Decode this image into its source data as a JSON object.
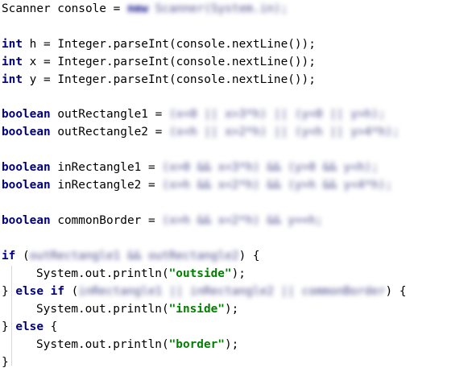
{
  "code": {
    "l1": {
      "a": "Scanner console = ",
      "b_kw": "new",
      "b_rest": " Scanner(System.in);"
    },
    "l3": {
      "kw": "int",
      "rest": " h = Integer.parseInt(console.nextLine());"
    },
    "l4": {
      "kw": "int",
      "rest": " x = Integer.parseInt(console.nextLine());"
    },
    "l5": {
      "kw": "int",
      "rest": " y = Integer.parseInt(console.nextLine());"
    },
    "l7": {
      "kw": "boolean",
      "rest": " outRectangle1 = ",
      "blurred": "(x<0 || x>3*h) || (y<0 || y>h);"
    },
    "l8": {
      "kw": "boolean",
      "rest": " outRectangle2 = ",
      "blurred": "(x<h || x>2*h) || (y<h || y>4*h);"
    },
    "l10": {
      "kw": "boolean",
      "rest": " inRectangle1 = ",
      "blurred": "(x>0 && x<3*h) && (y>0 && y<h);"
    },
    "l11": {
      "kw": "boolean",
      "rest": " inRectangle2 = ",
      "blurred": "(x>h && x<2*h) && (y>h && y<4*h);"
    },
    "l13": {
      "kw": "boolean",
      "rest": " commonBorder = ",
      "blurred": "(x>h && x<2*h) && y==h;"
    },
    "l15": {
      "kw": "if",
      "a": " (",
      "blurred": "outRectangle1 && outRectangle2",
      "b": ") {"
    },
    "l16": {
      "a": "System.out.println(",
      "str": "\"outside\"",
      "b": ");"
    },
    "l17": {
      "a": "} ",
      "kw1": "else",
      "mid": " ",
      "kw2": "if",
      "b": " (",
      "blurred": "inRectangle1 || inRectangle2 || commonBorder",
      "c": ") {"
    },
    "l18": {
      "a": "System.out.println(",
      "str": "\"inside\"",
      "b": ");"
    },
    "l19": {
      "a": "} ",
      "kw": "else",
      "b": " {"
    },
    "l20": {
      "a": "System.out.println(",
      "str": "\"border\"",
      "b": ");"
    },
    "l21": {
      "a": "}"
    }
  }
}
